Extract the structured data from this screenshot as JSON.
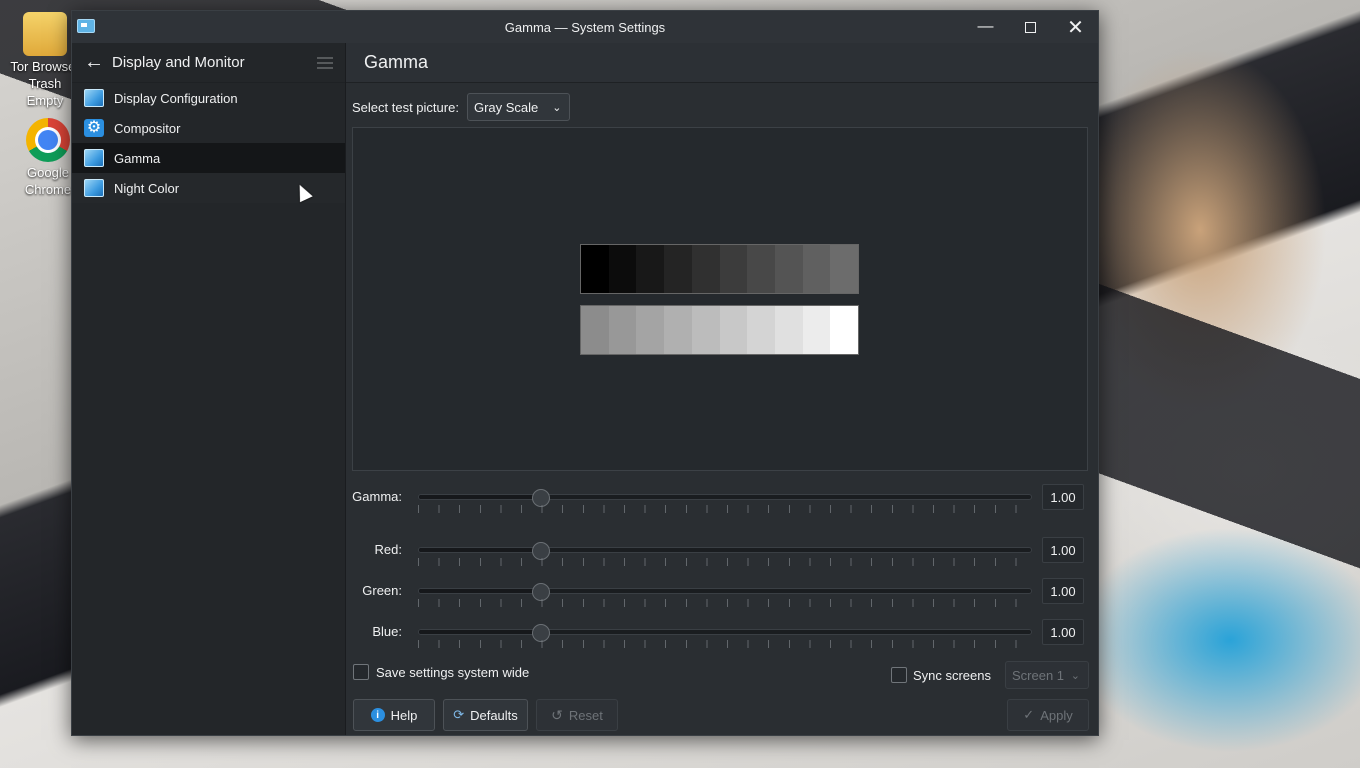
{
  "desktop": {
    "icons": [
      {
        "label": "Tor Browser"
      },
      {
        "label": "Trash\nEmpty"
      },
      {
        "label": "Google\nChrome"
      }
    ]
  },
  "window": {
    "title": "Gamma — System Settings"
  },
  "sidebar": {
    "title": "Display and Monitor",
    "items": [
      {
        "label": "Display Configuration",
        "icon": "monitor-icon"
      },
      {
        "label": "Compositor",
        "icon": "gear-icon"
      },
      {
        "label": "Gamma",
        "icon": "monitor-icon",
        "active": true
      },
      {
        "label": "Night Color",
        "icon": "monitor-icon"
      }
    ]
  },
  "main": {
    "title": "Gamma",
    "test_picture_label": "Select test picture:",
    "test_picture_value": "Gray Scale",
    "dark_strip": [
      "#000000",
      "#0c0c0c",
      "#181818",
      "#242424",
      "#303030",
      "#3c3c3c",
      "#484848",
      "#545454",
      "#606060",
      "#6c6c6c"
    ],
    "light_strip": [
      "#8c8c8c",
      "#989898",
      "#a4a4a4",
      "#b0b0b0",
      "#bcbcbc",
      "#c8c8c8",
      "#d4d4d4",
      "#e0e0e0",
      "#ececec",
      "#ffffff"
    ],
    "sliders": [
      {
        "label": "Gamma:",
        "value": "1.00",
        "level": 0.2
      },
      {
        "label": "Red:",
        "value": "1.00",
        "level": 0.2
      },
      {
        "label": "Green:",
        "value": "1.00",
        "level": 0.2
      },
      {
        "label": "Blue:",
        "value": "1.00",
        "level": 0.2
      }
    ],
    "save_system_wide_label": "Save settings system wide",
    "sync_screens_label": "Sync screens",
    "screen_select_value": "Screen 1"
  },
  "buttons": {
    "help": "Help",
    "defaults": "Defaults",
    "reset": "Reset",
    "apply": "Apply"
  },
  "colors": {
    "accent": "#2b8fe0",
    "window_bg": "#2a2e32",
    "sidebar_bg": "#232629"
  }
}
